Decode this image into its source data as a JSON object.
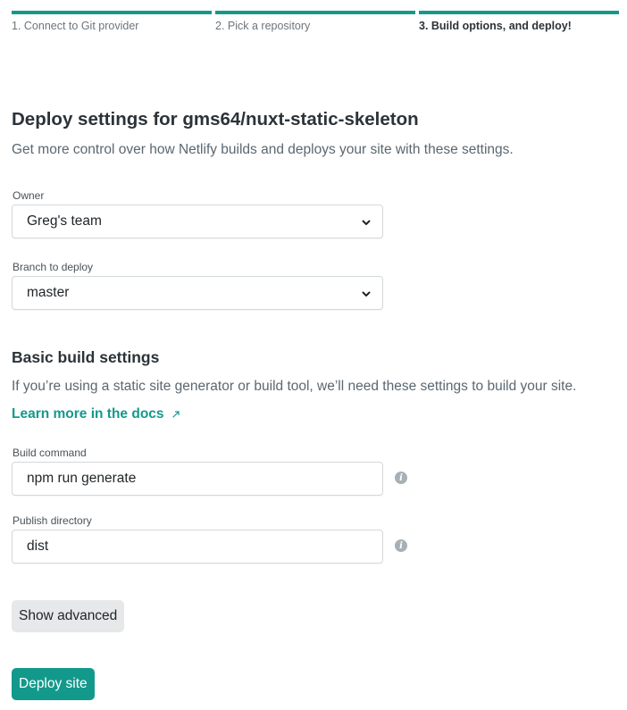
{
  "steps": [
    {
      "label": "1. Connect to Git provider"
    },
    {
      "label": "2. Pick a repository"
    },
    {
      "label": "3. Build options, and deploy!"
    }
  ],
  "header": {
    "title": "Deploy settings for gms64/nuxt-static-skeleton",
    "subtitle": "Get more control over how Netlify builds and deploys your site with these settings."
  },
  "owner": {
    "label": "Owner",
    "value": "Greg's team"
  },
  "branch": {
    "label": "Branch to deploy",
    "value": "master"
  },
  "build_settings": {
    "title": "Basic build settings",
    "description": "If you’re using a static site generator or build tool, we’ll need these settings to build your site.",
    "docs_link": "Learn more in the docs"
  },
  "build_command": {
    "label": "Build command",
    "value": "npm run generate"
  },
  "publish_directory": {
    "label": "Publish directory",
    "value": "dist"
  },
  "buttons": {
    "show_advanced": "Show advanced",
    "deploy": "Deploy site"
  },
  "colors": {
    "accent": "#13998b",
    "text": "#2c3338",
    "muted": "#5b6770"
  }
}
